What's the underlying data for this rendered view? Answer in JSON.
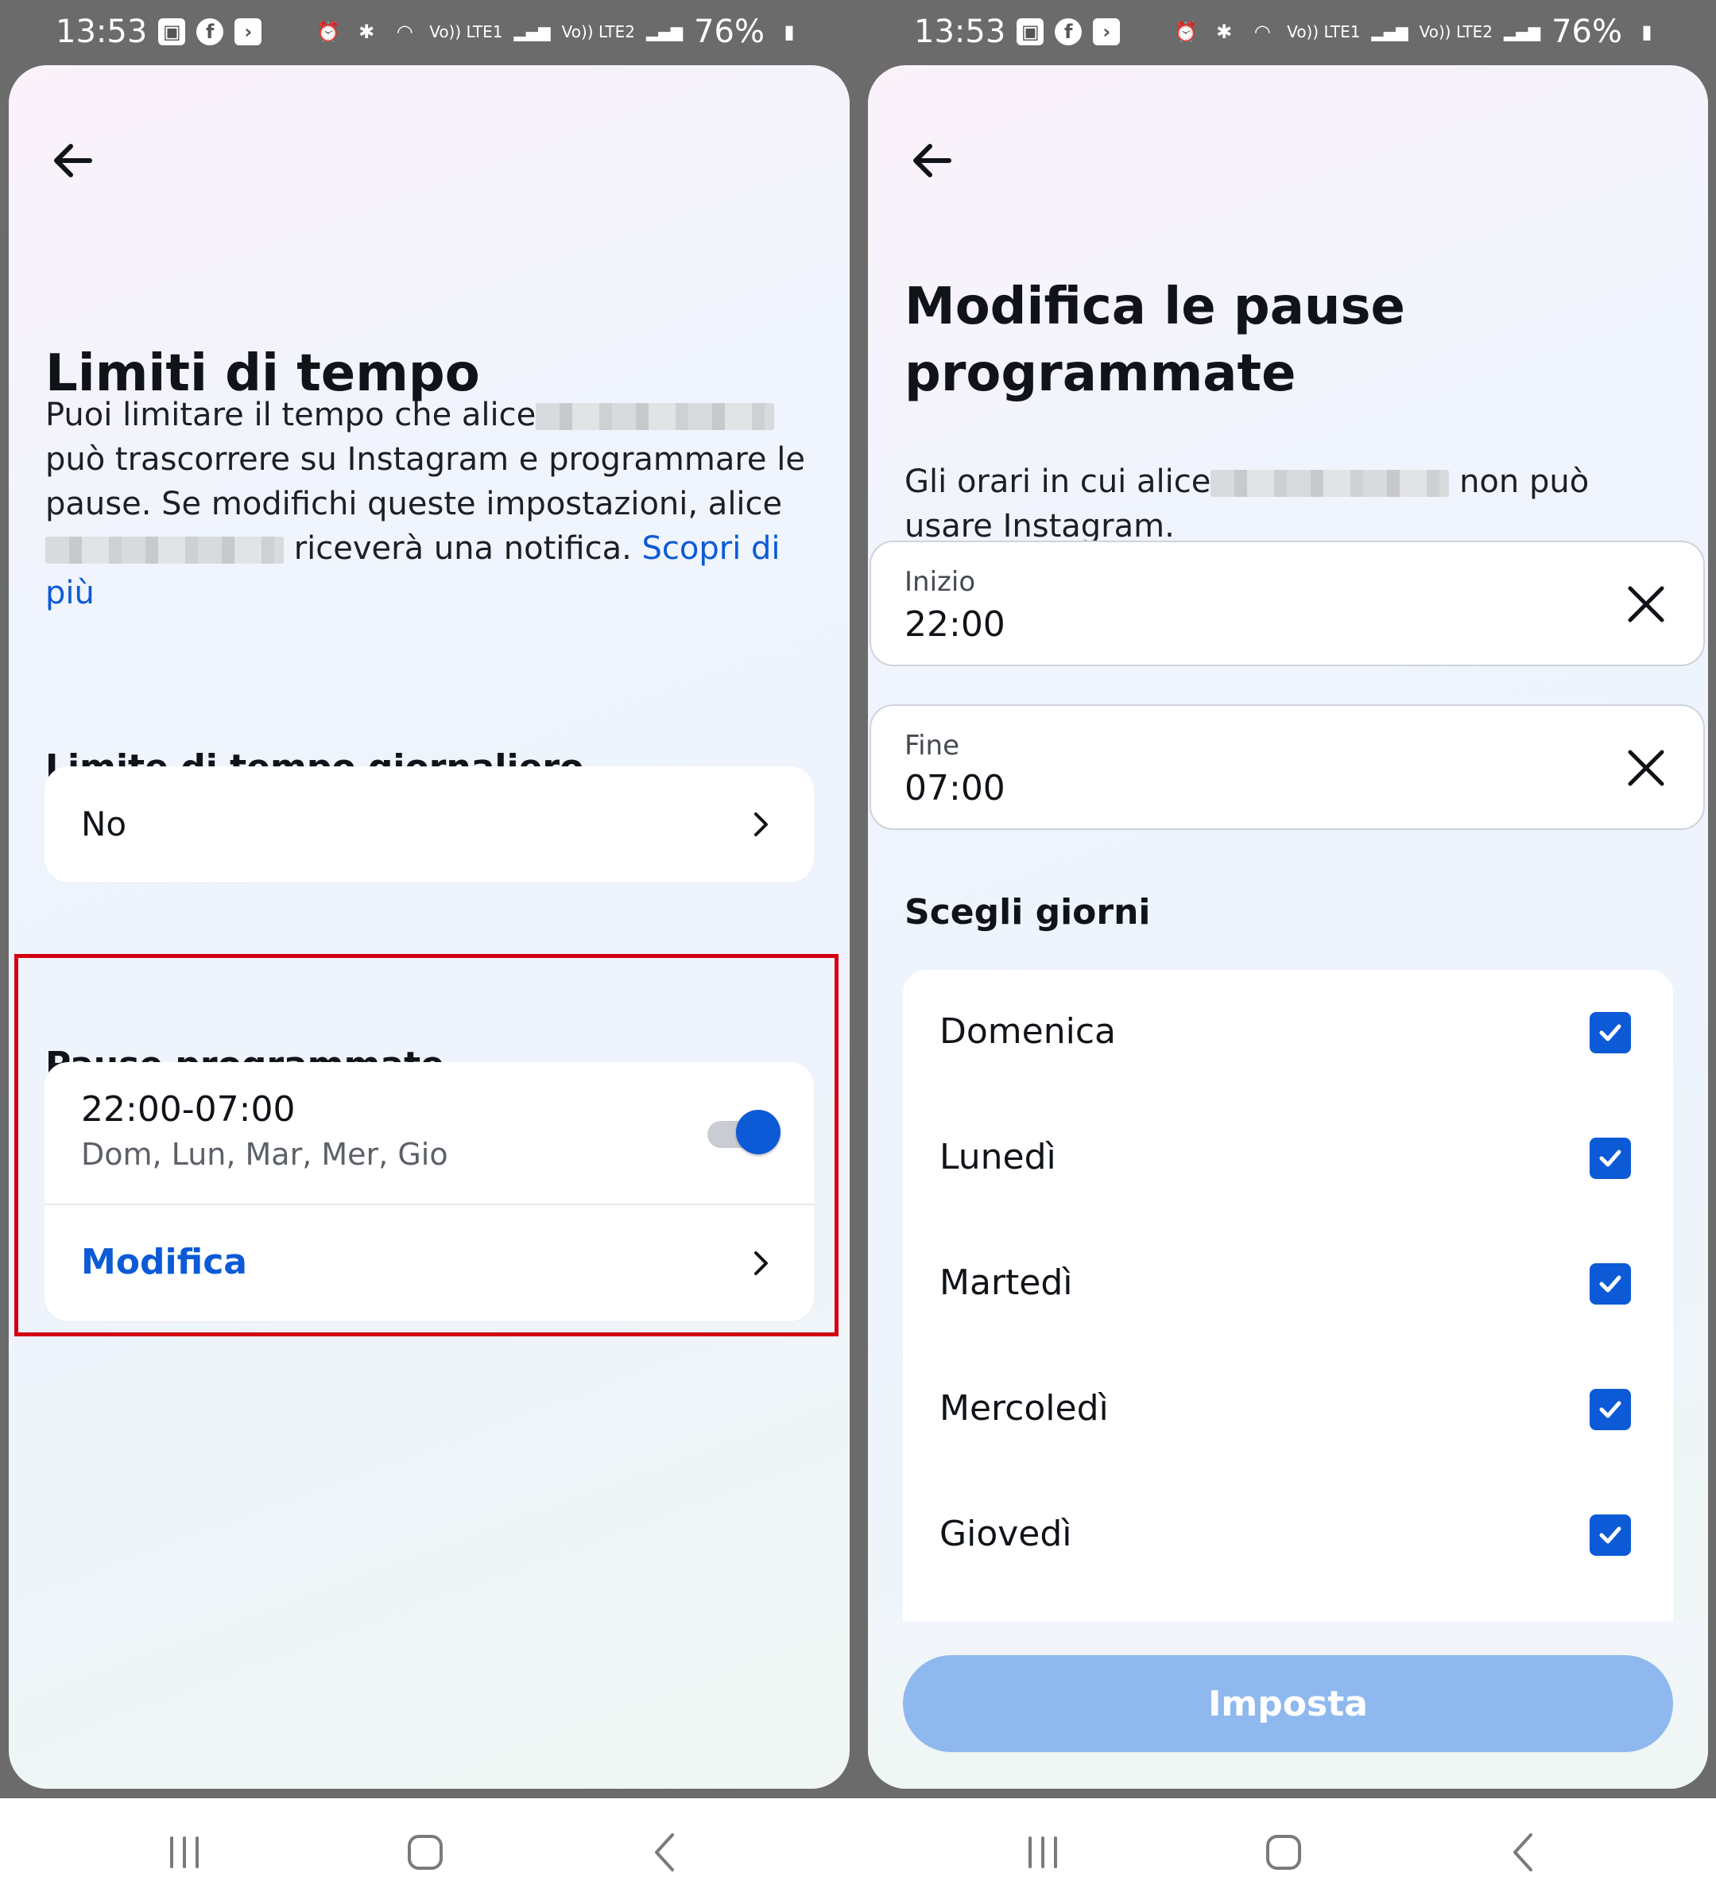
{
  "status_bar": {
    "time": "13:53",
    "battery": "76%",
    "icons": [
      "image-icon",
      "facebook-icon",
      "app-icon",
      "alarm-icon",
      "bluetooth-icon",
      "wifi-icon",
      "volte-lte1-icon",
      "signal-icon",
      "volte-lte2-icon",
      "signal-icon",
      "battery-icon"
    ],
    "volte1": "Vo)) LTE1",
    "volte2": "Vo)) LTE2"
  },
  "screen1": {
    "title": "Limiti di tempo",
    "desc_part1": "Puoi limitare il tempo che alice",
    "desc_part2": "può trascorrere su Instagram e programmare le pause. Se modifichi queste impostazioni, alice",
    "desc_part3": "riceverà una notifica.",
    "learn_more": "Scopri di più",
    "daily_limit_heading": "Limite di tempo giornaliero",
    "daily_limit_value": "No",
    "scheduled_heading": "Pause programmate",
    "schedule_time": "22:00-07:00",
    "schedule_days": "Dom, Lun, Mar, Mer, Gio",
    "schedule_enabled": true,
    "edit_label": "Modifica"
  },
  "screen2": {
    "title_line1": "Modifica le pause",
    "title_line2": "programmate",
    "desc_part1": "Gli orari in cui alice",
    "desc_part2": "non può usare Instagram.",
    "start_label": "Inizio",
    "start_value": "22:00",
    "end_label": "Fine",
    "end_value": "07:00",
    "days_heading": "Scegli giorni",
    "days": [
      {
        "label": "Domenica",
        "checked": true
      },
      {
        "label": "Lunedì",
        "checked": true
      },
      {
        "label": "Martedì",
        "checked": true
      },
      {
        "label": "Mercoledì",
        "checked": true
      },
      {
        "label": "Giovedì",
        "checked": true
      }
    ],
    "submit_label": "Imposta"
  },
  "colors": {
    "accent": "#0c5ad6",
    "highlight_border": "#d20012",
    "disabled_button": "#8fb9ee"
  }
}
